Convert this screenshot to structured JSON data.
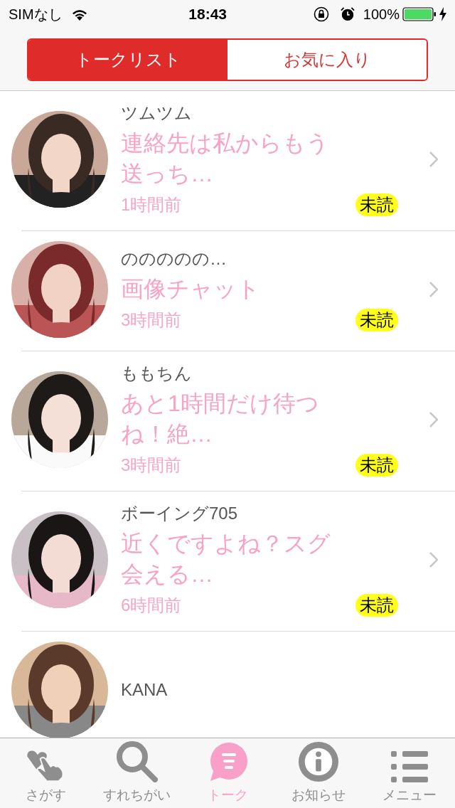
{
  "status_bar": {
    "carrier": "SIMなし",
    "time": "18:43",
    "battery": "100%"
  },
  "segments": [
    {
      "label": "トークリスト",
      "selected": true
    },
    {
      "label": "お気に入り",
      "selected": false
    }
  ],
  "conversations": [
    {
      "name": "ツムツム",
      "message": "連絡先は私からもう送っち…",
      "time": "1時間前",
      "badge": "未読"
    },
    {
      "name": "ののののの…",
      "message": "画像チャット",
      "time": "3時間前",
      "badge": "未読"
    },
    {
      "name": "ももちん",
      "message": "あと1時間だけ待つね！絶…",
      "time": "3時間前",
      "badge": "未読"
    },
    {
      "name": "ボーイング705",
      "message": "近くですよね？スグ会える…",
      "time": "6時間前",
      "badge": "未読"
    },
    {
      "name": "KANA"
    }
  ],
  "tab_bar": [
    {
      "kind": "hand",
      "label": "さがす",
      "selected": false
    },
    {
      "kind": "search",
      "label": "すれちがい",
      "selected": false
    },
    {
      "kind": "chat",
      "label": "トーク",
      "selected": true
    },
    {
      "kind": "info",
      "label": "お知らせ",
      "selected": false
    },
    {
      "kind": "menu",
      "label": "メニュー",
      "selected": false
    }
  ]
}
